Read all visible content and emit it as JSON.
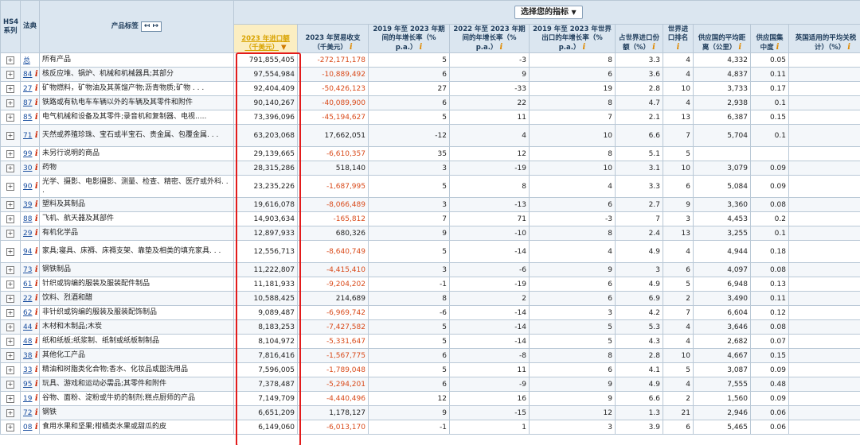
{
  "header": {
    "hs4": "HS4系列",
    "code": "法典",
    "product_label": "产品标签",
    "toggle": "↤ ↦",
    "indicator_select": "选择您的指标",
    "columns": [
      "2023 年进口额（千美元）",
      "2023 年贸易收支（千美元）",
      "2019 年至 2023 年期间的年增长率（% p.a.）",
      "2022 年至 2023 年期间的年增长率（% p.a.）",
      "2019 年至 2023 年世界出口的年增长率（% p.a.）",
      "占世界进口份额（%）",
      "世界进口排名",
      "供应国的平均距离（公里）",
      "供应国集中度",
      "英国适用的平均关税（估计）（%）"
    ]
  },
  "rows": [
    {
      "code": "总",
      "name": "所有产品",
      "v": [
        "791,855,405",
        "-272,171,178",
        "5",
        "-3",
        "8",
        "3.3",
        "4",
        "4,332",
        "0.05",
        "0.8"
      ]
    },
    {
      "code": "84",
      "name": "核反应堆、锅炉、机械和机械器具;其部分",
      "v": [
        "97,554,984",
        "-10,889,492",
        "6",
        "9",
        "6",
        "3.6",
        "4",
        "4,837",
        "0.11",
        "0.2"
      ]
    },
    {
      "code": "27",
      "name": "矿物燃料，矿物油及其蒸馏产物;沥青物质;矿物 . . .",
      "v": [
        "92,404,409",
        "-50,426,123",
        "27",
        "-33",
        "19",
        "2.8",
        "10",
        "3,733",
        "0.17",
        "0.1"
      ]
    },
    {
      "code": "87",
      "name": "铁路或有轨电车车辆以外的车辆及其零件和附件",
      "v": [
        "90,140,267",
        "-40,089,900",
        "6",
        "22",
        "8",
        "4.7",
        "4",
        "2,938",
        "0.1",
        "2.1"
      ]
    },
    {
      "code": "85",
      "name": "电气机械和设备及其零件;录音机和复制器、电视.....",
      "v": [
        "73,396,096",
        "-45,194,627",
        "5",
        "11",
        "7",
        "2.1",
        "13",
        "6,387",
        "0.15",
        "0.2"
      ]
    },
    {
      "code": "71",
      "name": "天然或养殖珍珠、宝石或半宝石、贵金属、包覆金属. . .",
      "v": [
        "63,203,068",
        "17,662,051",
        "-12",
        "4",
        "10",
        "6.6",
        "7",
        "5,704",
        "0.1",
        "0.1"
      ],
      "tall": true
    },
    {
      "code": "99",
      "name": "未另行说明的商品",
      "v": [
        "29,139,665",
        "-6,610,357",
        "35",
        "12",
        "8",
        "5.1",
        "5",
        "",
        "",
        ""
      ]
    },
    {
      "code": "30",
      "name": "药物",
      "v": [
        "28,315,286",
        "518,140",
        "3",
        "-19",
        "10",
        "3.1",
        "10",
        "3,079",
        "0.09",
        "0"
      ]
    },
    {
      "code": "90",
      "name": "光学、摄影、电影摄影、测量、检查、精密、医疗或外科. . .",
      "v": [
        "23,235,226",
        "-1,687,995",
        "5",
        "8",
        "4",
        "3.3",
        "6",
        "5,084",
        "0.09",
        "0.1"
      ],
      "tall": true
    },
    {
      "code": "39",
      "name": "塑料及其制品",
      "v": [
        "19,616,078",
        "-8,066,489",
        "3",
        "-13",
        "6",
        "2.7",
        "9",
        "3,360",
        "0.08",
        "1.4"
      ]
    },
    {
      "code": "88",
      "name": "飞机、航天器及其部件",
      "v": [
        "14,903,634",
        "-165,812",
        "7",
        "71",
        "-3",
        "7",
        "3",
        "4,453",
        "0.2",
        "0"
      ]
    },
    {
      "code": "29",
      "name": "有机化学品",
      "v": [
        "12,897,933",
        "680,326",
        "9",
        "-10",
        "8",
        "2.4",
        "13",
        "3,255",
        "0.1",
        "0.7"
      ]
    },
    {
      "code": "94",
      "name": "家具;寝具、床褥、床褥支架、靠垫及相类的填充家具. . .",
      "v": [
        "12,556,713",
        "-8,640,749",
        "5",
        "-14",
        "4",
        "4.9",
        "4",
        "4,944",
        "0.18",
        "0.2"
      ],
      "tall": true
    },
    {
      "code": "73",
      "name": "钢铁制品",
      "v": [
        "11,222,807",
        "-4,415,410",
        "3",
        "-6",
        "9",
        "3",
        "6",
        "4,097",
        "0.08",
        "0.1"
      ]
    },
    {
      "code": "61",
      "name": "针织或钩编的服装及服装配件制品",
      "v": [
        "11,181,933",
        "-9,204,202",
        "-1",
        "-19",
        "6",
        "4.9",
        "5",
        "6,948",
        "0.13",
        "3.4"
      ]
    },
    {
      "code": "22",
      "name": "饮料、烈酒和醋",
      "v": [
        "10,588,425",
        "214,689",
        "8",
        "2",
        "6",
        "6.9",
        "2",
        "3,490",
        "0.11",
        "1.2"
      ]
    },
    {
      "code": "62",
      "name": "非针织或钩编的服装及服装配饰制品",
      "v": [
        "9,089,487",
        "-6,969,742",
        "-6",
        "-14",
        "3",
        "4.2",
        "7",
        "6,604",
        "0.12",
        "3.3"
      ]
    },
    {
      "code": "44",
      "name": "木材和木制品;木炭",
      "v": [
        "8,183,253",
        "-7,427,582",
        "5",
        "-14",
        "5",
        "5.3",
        "4",
        "3,646",
        "0.08",
        "0.4"
      ]
    },
    {
      "code": "48",
      "name": "纸和纸板;纸浆制、纸制或纸板制制品",
      "v": [
        "8,104,972",
        "-5,331,647",
        "5",
        "-14",
        "5",
        "4.3",
        "4",
        "2,682",
        "0.07",
        "0"
      ]
    },
    {
      "code": "38",
      "name": "其他化工产品",
      "v": [
        "7,816,416",
        "-1,567,775",
        "6",
        "-8",
        "8",
        "2.8",
        "10",
        "4,667",
        "0.15",
        "0.8"
      ]
    },
    {
      "code": "33",
      "name": "精油和树脂类化合物;香水、化妆品或盥洗用品",
      "v": [
        "7,596,005",
        "-1,789,048",
        "5",
        "11",
        "6",
        "4.1",
        "5",
        "3,087",
        "0.09",
        "0.2"
      ]
    },
    {
      "code": "95",
      "name": "玩具、游戏和运动必需品;其零件和附件",
      "v": [
        "7,378,487",
        "-5,294,201",
        "6",
        "-9",
        "9",
        "4.9",
        "4",
        "7,555",
        "0.48",
        "3.5"
      ]
    },
    {
      "code": "19",
      "name": "谷物、面粉、淀粉或牛奶的制剂;糕点厨师的产品",
      "v": [
        "7,149,709",
        "-4,440,496",
        "12",
        "16",
        "9",
        "6.6",
        "2",
        "1,560",
        "0.09",
        "3.6"
      ]
    },
    {
      "code": "72",
      "name": "钢铁",
      "v": [
        "6,651,209",
        "1,178,127",
        "9",
        "-15",
        "12",
        "1.3",
        "21",
        "2,946",
        "0.06",
        "0"
      ]
    },
    {
      "code": "08",
      "name": "食用水果和坚果;柑橘类水果或甜瓜的皮",
      "v": [
        "6,149,060",
        "-6,013,170",
        "-1",
        "1",
        "3",
        "3.9",
        "6",
        "5,465",
        "0.06",
        "2"
      ]
    }
  ]
}
